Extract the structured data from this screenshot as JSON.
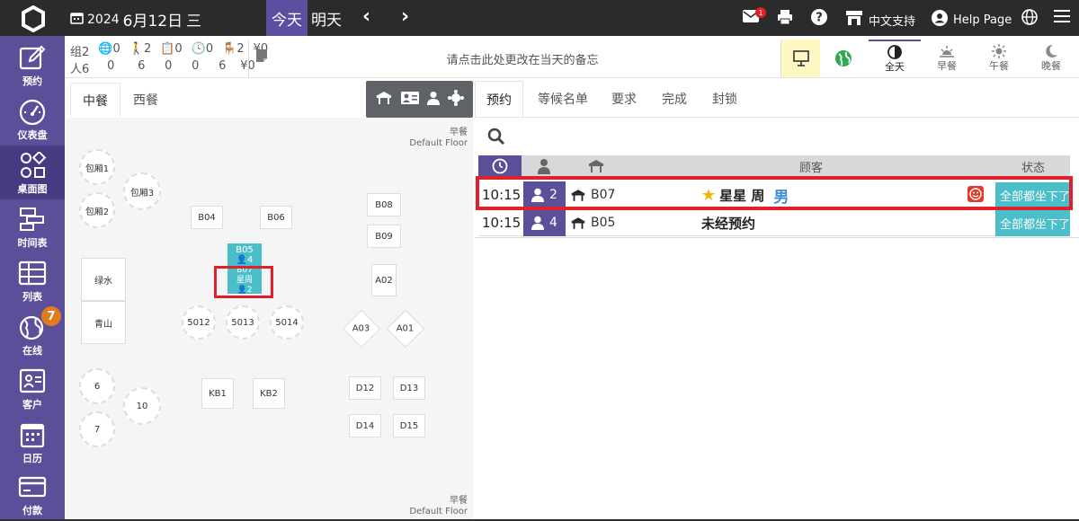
{
  "header": {
    "year": "2024",
    "date": "6月12日",
    "weekday": "三",
    "today_label": "今天",
    "tomorrow_label": "明天",
    "mail_badge": "1",
    "language_label": "中文支持",
    "help_label": "Help Page"
  },
  "sidebar": {
    "items": [
      {
        "label": "预约",
        "icon": "edit-icon"
      },
      {
        "label": "仪表盘",
        "icon": "dashboard-icon"
      },
      {
        "label": "桌面图",
        "icon": "floorplan-icon"
      },
      {
        "label": "时间表",
        "icon": "timeline-icon"
      },
      {
        "label": "列表",
        "icon": "table-list-icon"
      },
      {
        "label": "在线",
        "icon": "globe-icon"
      },
      {
        "label": "客户",
        "icon": "contact-card-icon"
      },
      {
        "label": "日历",
        "icon": "calendar-icon"
      },
      {
        "label": "付款",
        "icon": "credit-card-icon"
      }
    ],
    "online_badge": "7"
  },
  "stats": {
    "row1": {
      "groups": "组2",
      "online": "0",
      "walkin": "2",
      "waitlist": "0",
      "time": "0",
      "seat": "2",
      "money": "¥0"
    },
    "row2": {
      "people": "人6",
      "online": "0",
      "walkin": "6",
      "waitlist": "0",
      "time": "0",
      "seat": "6",
      "money": "¥0"
    }
  },
  "memo_placeholder": "请点击此处更改在当天的备忘",
  "meals": [
    {
      "label": "全天",
      "icon": "half-moon-icon"
    },
    {
      "label": "早餐",
      "icon": "sunrise-icon"
    },
    {
      "label": "午餐",
      "icon": "sun-icon"
    },
    {
      "label": "晚餐",
      "icon": "moon-icon"
    }
  ],
  "floor_tabs": [
    "中餐",
    "西餐"
  ],
  "floor_labels": {
    "top": {
      "meal": "早餐",
      "floor": "Default Floor"
    },
    "bottom": {
      "meal": "早餐",
      "floor": "Default Floor"
    }
  },
  "tables": {
    "baoxiang1": "包厢1",
    "baoxiang2": "包厢2",
    "baoxiang3": "包厢3",
    "lvshui": "绿水",
    "qingshan": "青山",
    "b04": "B04",
    "b06": "B06",
    "b08": "B08",
    "b09": "B09",
    "b05": "B05",
    "b05_count": "4",
    "b07": "B07",
    "b07_guest": "星周",
    "b07_count": "2",
    "a02": "A02",
    "a03": "A03",
    "a01": "A01",
    "t5012": "5012",
    "t5013": "5013",
    "t5014": "5014",
    "t6": "6",
    "t7": "7",
    "t10": "10",
    "kb1": "KB1",
    "kb2": "KB2",
    "d12": "D12",
    "d13": "D13",
    "d14": "D14",
    "d15": "D15"
  },
  "right_tabs": [
    "预约",
    "等候名单",
    "要求",
    "完成",
    "封锁"
  ],
  "table_header": {
    "guest": "顾客",
    "status": "状态"
  },
  "reservations": [
    {
      "time": "10:15",
      "party": "2",
      "table": "B07",
      "guest": "星星 周",
      "gender": "男",
      "status": "全部都坐下了"
    },
    {
      "time": "10:15",
      "party": "4",
      "table": "B05",
      "guest": "未经预约",
      "gender": "",
      "status": "全部都坐下了"
    }
  ],
  "colors": {
    "brand": "#5b4f99",
    "seated": "#4bbfc9",
    "highlight": "#e0202a"
  }
}
